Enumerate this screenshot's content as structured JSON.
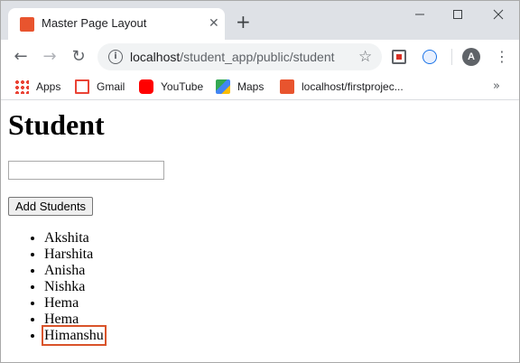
{
  "browser": {
    "tab": {
      "title": "Master Page Layout",
      "favicon": "xampp-icon",
      "close_glyph": "✕"
    },
    "new_tab_glyph": "+",
    "window_controls": {
      "minimize": "—",
      "maximize": "☐",
      "close": "✕"
    },
    "toolbar": {
      "back_glyph": "←",
      "forward_glyph": "→",
      "reload_glyph": "↻",
      "url_host": "localhost",
      "url_path": "/student_app/public/student",
      "info_glyph": "i",
      "star_glyph": "☆",
      "avatar_letter": "A",
      "menu_glyph": "⋮"
    },
    "bookmarks": [
      {
        "label": "Apps",
        "icon": "apps-grid-icon"
      },
      {
        "label": "Gmail",
        "icon": "gmail-icon"
      },
      {
        "label": "YouTube",
        "icon": "youtube-icon"
      },
      {
        "label": "Maps",
        "icon": "maps-icon"
      },
      {
        "label": "localhost/firstprojec...",
        "icon": "xampp-icon"
      }
    ],
    "bookmarks_more_glyph": "»"
  },
  "page": {
    "heading": "Student",
    "name_input": {
      "value": "",
      "placeholder": ""
    },
    "add_button_label": "Add Students",
    "students": [
      "Akshita",
      "Harshita",
      "Anisha",
      "Nishka",
      "Hema",
      "Hema",
      "Himanshu"
    ],
    "highlighted_student_index": 6,
    "highlight_color": "#d9532a"
  }
}
